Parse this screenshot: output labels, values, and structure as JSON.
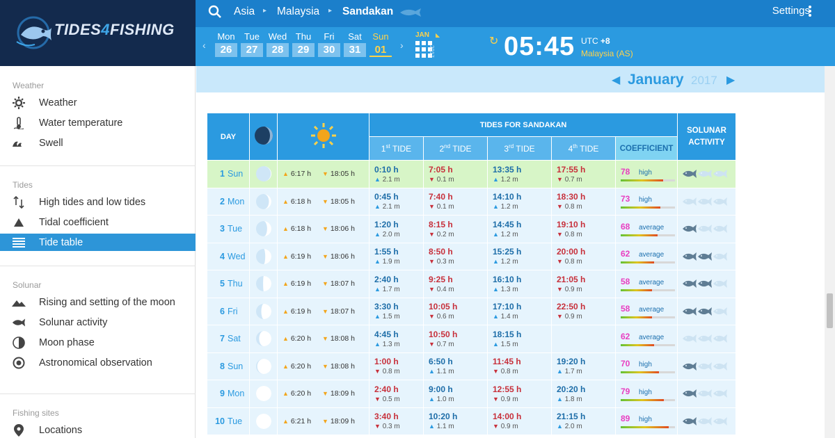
{
  "brand": {
    "word_a": "TIDES",
    "word_b": "4",
    "word_c": "FISHING"
  },
  "sidebar": {
    "sections": [
      {
        "title": "Weather",
        "items": [
          {
            "label": "Weather",
            "icon": "gear-sun-icon"
          },
          {
            "label": "Water temperature",
            "icon": "thermometer-icon"
          },
          {
            "label": "Swell",
            "icon": "wave-icon"
          }
        ]
      },
      {
        "title": "Tides",
        "items": [
          {
            "label": "High tides and low tides",
            "icon": "up-down-arrows-icon"
          },
          {
            "label": "Tidal coefficient",
            "icon": "triangle-icon"
          },
          {
            "label": "Tide table",
            "icon": "list-icon",
            "active": true
          }
        ]
      },
      {
        "title": "Solunar",
        "items": [
          {
            "label": "Rising and setting of the moon",
            "icon": "mountain-icon"
          },
          {
            "label": "Solunar activity",
            "icon": "fish-icon"
          },
          {
            "label": "Moon phase",
            "icon": "half-circle-icon"
          },
          {
            "label": "Astronomical observation",
            "icon": "target-icon"
          }
        ]
      },
      {
        "title": "Fishing sites",
        "items": [
          {
            "label": "Locations",
            "icon": "map-pin-icon"
          }
        ]
      }
    ]
  },
  "topbar": {
    "crumbs": [
      "Asia",
      "Malaysia",
      "Sandakan"
    ],
    "settings": "Settings"
  },
  "datebar": {
    "days": [
      {
        "name": "Mon",
        "num": "26"
      },
      {
        "name": "Tue",
        "num": "27"
      },
      {
        "name": "Wed",
        "num": "28"
      },
      {
        "name": "Thu",
        "num": "29"
      },
      {
        "name": "Fri",
        "num": "30"
      },
      {
        "name": "Sat",
        "num": "31"
      },
      {
        "name": "Sun",
        "num": "01",
        "today": true
      }
    ],
    "cal_month": "JAN",
    "cal_year": "2017",
    "time": "05:45",
    "utc_label": "UTC",
    "utc_offset": "+8",
    "timezone": "Malaysia (AS)"
  },
  "month": {
    "name": "January",
    "year": "2017"
  },
  "table": {
    "h_day": "DAY",
    "h_tides": "TIDES FOR SANDAKAN",
    "h_solunar": "SOLUNAR ACTIVITY",
    "h_tide_nums": [
      "1",
      "2",
      "3",
      "4"
    ],
    "h_tide_sups": [
      "st",
      "nd",
      "rd",
      "th"
    ],
    "h_tide_word": "TIDE",
    "h_coef": "COEFFICIENT",
    "colors": {
      "header": "#2b9ae0",
      "sub": "#5ab5ec",
      "high": "#1d6da8",
      "low": "#c7303b",
      "coef": "#e83ec0",
      "today_row": "#d7f5c7",
      "row": "#e6f4fd"
    },
    "rows": [
      {
        "num": "1",
        "day": "Sun",
        "today": true,
        "phase": 0.02,
        "rise": "6:17 h",
        "set": "18:05 h",
        "tides": [
          {
            "t": "0:10 h",
            "h": "2.1 m",
            "k": "hi"
          },
          {
            "t": "7:05 h",
            "h": "0.1 m",
            "k": "lo"
          },
          {
            "t": "13:35 h",
            "h": "1.2 m",
            "k": "hi"
          },
          {
            "t": "17:55 h",
            "h": "0.7 m",
            "k": "lo"
          }
        ],
        "coef": "78",
        "coef_label": "high",
        "coef_level": 0.78,
        "fish": [
          2,
          0,
          0
        ]
      },
      {
        "num": "2",
        "day": "Mon",
        "phase": 0.08,
        "rise": "6:18 h",
        "set": "18:05 h",
        "tides": [
          {
            "t": "0:45 h",
            "h": "2.1 m",
            "k": "hi"
          },
          {
            "t": "7:40 h",
            "h": "0.1 m",
            "k": "lo"
          },
          {
            "t": "14:10 h",
            "h": "1.2 m",
            "k": "hi"
          },
          {
            "t": "18:30 h",
            "h": "0.8 m",
            "k": "lo"
          }
        ],
        "coef": "73",
        "coef_label": "high",
        "coef_level": 0.73,
        "fish": [
          0,
          0,
          0
        ]
      },
      {
        "num": "3",
        "day": "Tue",
        "phase": 0.14,
        "rise": "6:18 h",
        "set": "18:06 h",
        "tides": [
          {
            "t": "1:20 h",
            "h": "2.0 m",
            "k": "hi"
          },
          {
            "t": "8:15 h",
            "h": "0.2 m",
            "k": "lo"
          },
          {
            "t": "14:45 h",
            "h": "1.2 m",
            "k": "hi"
          },
          {
            "t": "19:10 h",
            "h": "0.8 m",
            "k": "lo"
          }
        ],
        "coef": "68",
        "coef_label": "average",
        "coef_level": 0.68,
        "fish": [
          2,
          0,
          0
        ]
      },
      {
        "num": "4",
        "day": "Wed",
        "phase": 0.2,
        "rise": "6:19 h",
        "set": "18:06 h",
        "tides": [
          {
            "t": "1:55 h",
            "h": "1.9 m",
            "k": "hi"
          },
          {
            "t": "8:50 h",
            "h": "0.3 m",
            "k": "lo"
          },
          {
            "t": "15:25 h",
            "h": "1.2 m",
            "k": "hi"
          },
          {
            "t": "20:00 h",
            "h": "0.8 m",
            "k": "lo"
          }
        ],
        "coef": "62",
        "coef_label": "average",
        "coef_level": 0.62,
        "fish": [
          2,
          2,
          0
        ]
      },
      {
        "num": "5",
        "day": "Thu",
        "phase": 0.27,
        "rise": "6:19 h",
        "set": "18:07 h",
        "tides": [
          {
            "t": "2:40 h",
            "h": "1.7 m",
            "k": "hi"
          },
          {
            "t": "9:25 h",
            "h": "0.4 m",
            "k": "lo"
          },
          {
            "t": "16:10 h",
            "h": "1.3 m",
            "k": "hi"
          },
          {
            "t": "21:05 h",
            "h": "0.9 m",
            "k": "lo"
          }
        ],
        "coef": "58",
        "coef_label": "average",
        "coef_level": 0.58,
        "fish": [
          2,
          2,
          0
        ]
      },
      {
        "num": "6",
        "day": "Fri",
        "phase": 0.33,
        "rise": "6:19 h",
        "set": "18:07 h",
        "tides": [
          {
            "t": "3:30 h",
            "h": "1.5 m",
            "k": "hi"
          },
          {
            "t": "10:05 h",
            "h": "0.6 m",
            "k": "lo"
          },
          {
            "t": "17:10 h",
            "h": "1.4 m",
            "k": "hi"
          },
          {
            "t": "22:50 h",
            "h": "0.9 m",
            "k": "lo"
          }
        ],
        "coef": "58",
        "coef_label": "average",
        "coef_level": 0.58,
        "fish": [
          2,
          2,
          0
        ]
      },
      {
        "num": "7",
        "day": "Sat",
        "phase": 0.4,
        "rise": "6:20 h",
        "set": "18:08 h",
        "tides": [
          {
            "t": "4:45 h",
            "h": "1.3 m",
            "k": "hi"
          },
          {
            "t": "10:50 h",
            "h": "0.7 m",
            "k": "lo"
          },
          {
            "t": "18:15 h",
            "h": "1.5 m",
            "k": "hi"
          },
          {
            "t": "",
            "h": "",
            "k": "none"
          }
        ],
        "coef": "62",
        "coef_label": "average",
        "coef_level": 0.62,
        "fish": [
          0,
          0,
          0
        ]
      },
      {
        "num": "8",
        "day": "Sun",
        "phase": 0.46,
        "rise": "6:20 h",
        "set": "18:08 h",
        "tides": [
          {
            "t": "1:00 h",
            "h": "0.8 m",
            "k": "lo"
          },
          {
            "t": "6:50 h",
            "h": "1.1 m",
            "k": "hi"
          },
          {
            "t": "11:45 h",
            "h": "0.8 m",
            "k": "lo"
          },
          {
            "t": "19:20 h",
            "h": "1.7 m",
            "k": "hi"
          }
        ],
        "coef": "70",
        "coef_label": "high",
        "coef_level": 0.7,
        "fish": [
          2,
          0,
          0
        ]
      },
      {
        "num": "9",
        "day": "Mon",
        "phase": 0.5,
        "rise": "6:20 h",
        "set": "18:09 h",
        "tides": [
          {
            "t": "2:40 h",
            "h": "0.5 m",
            "k": "lo"
          },
          {
            "t": "9:00 h",
            "h": "1.0 m",
            "k": "hi"
          },
          {
            "t": "12:55 h",
            "h": "0.9 m",
            "k": "lo"
          },
          {
            "t": "20:20 h",
            "h": "1.8 m",
            "k": "hi"
          }
        ],
        "coef": "79",
        "coef_label": "high",
        "coef_level": 0.79,
        "fish": [
          2,
          0,
          0
        ]
      },
      {
        "num": "10",
        "day": "Tue",
        "phase": 0.5,
        "rise": "6:21 h",
        "set": "18:09 h",
        "tides": [
          {
            "t": "3:40 h",
            "h": "0.3 m",
            "k": "lo"
          },
          {
            "t": "10:20 h",
            "h": "1.1 m",
            "k": "hi"
          },
          {
            "t": "14:00 h",
            "h": "0.9 m",
            "k": "lo"
          },
          {
            "t": "21:15 h",
            "h": "2.0 m",
            "k": "hi"
          }
        ],
        "coef": "89",
        "coef_label": "high",
        "coef_level": 0.89,
        "fish": [
          2,
          0,
          0
        ]
      }
    ]
  }
}
